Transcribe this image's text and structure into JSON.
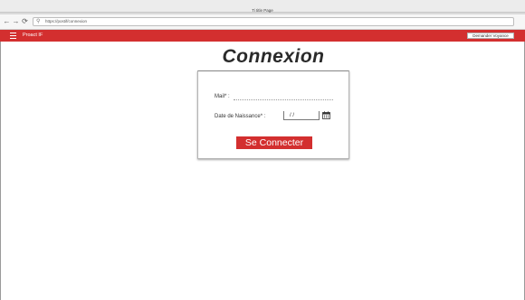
{
  "browser": {
    "window_title": "Ti title Page",
    "url": "https://postif/connexion",
    "back_icon": "arrow-left-icon",
    "forward_icon": "arrow-right-icon",
    "reload_icon": "reload-icon",
    "search_icon": "search-icon"
  },
  "header": {
    "brand": "Proact IF",
    "request_button": "Demander Voyance",
    "menu_icon": "hamburger-menu-icon",
    "accent_color": "#d32f2f"
  },
  "login": {
    "title": "Connexion",
    "mail_label": "Mail* :",
    "mail_value": "",
    "dob_label": "Date de Naissance* :",
    "dob_value": "/  /",
    "calendar_icon": "calendar-icon",
    "submit_label": "Se Connecter"
  }
}
